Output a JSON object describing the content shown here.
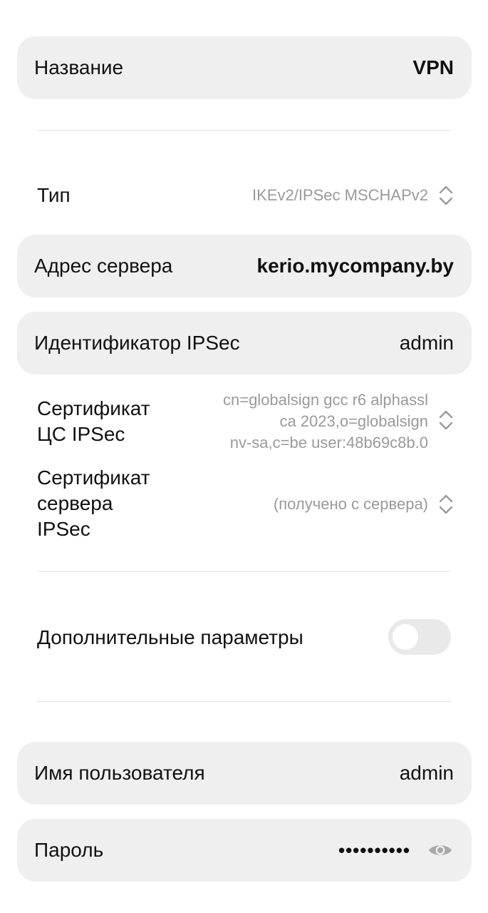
{
  "name_row": {
    "label": "Название",
    "value": "VPN"
  },
  "type_row": {
    "label": "Тип",
    "value": "IKEv2/IPSec MSCHAPv2"
  },
  "server_row": {
    "label": "Адрес сервера",
    "value": "kerio.mycompany.by"
  },
  "ipsec_id_row": {
    "label": "Идентификатор IPSec",
    "value": "admin"
  },
  "ca_cert_row": {
    "label_line1": "Сертификат",
    "label_line2": "ЦС IPSec",
    "value_line1": "cn=globalsign gcc r6 alphassl",
    "value_line2": "ca 2023,o=globalsign",
    "value_line3": "nv-sa,c=be user:48b69c8b.0"
  },
  "server_cert_row": {
    "label_line1": "Сертификат",
    "label_line2": "сервера",
    "label_line3": "IPSec",
    "value": "(получено с сервера)"
  },
  "advanced_row": {
    "label": "Дополнительные параметры",
    "toggle_on": false
  },
  "username_row": {
    "label": "Имя пользователя",
    "value": "admin"
  },
  "password_row": {
    "label": "Пароль",
    "value": "••••••••••"
  },
  "icons": {
    "chevron": "chevron-up-down-icon",
    "eye": "eye-icon"
  },
  "colors": {
    "card_bg": "#efefef",
    "secondary_text": "#9a9a9a",
    "toggle_off": "#e9e9e9"
  }
}
